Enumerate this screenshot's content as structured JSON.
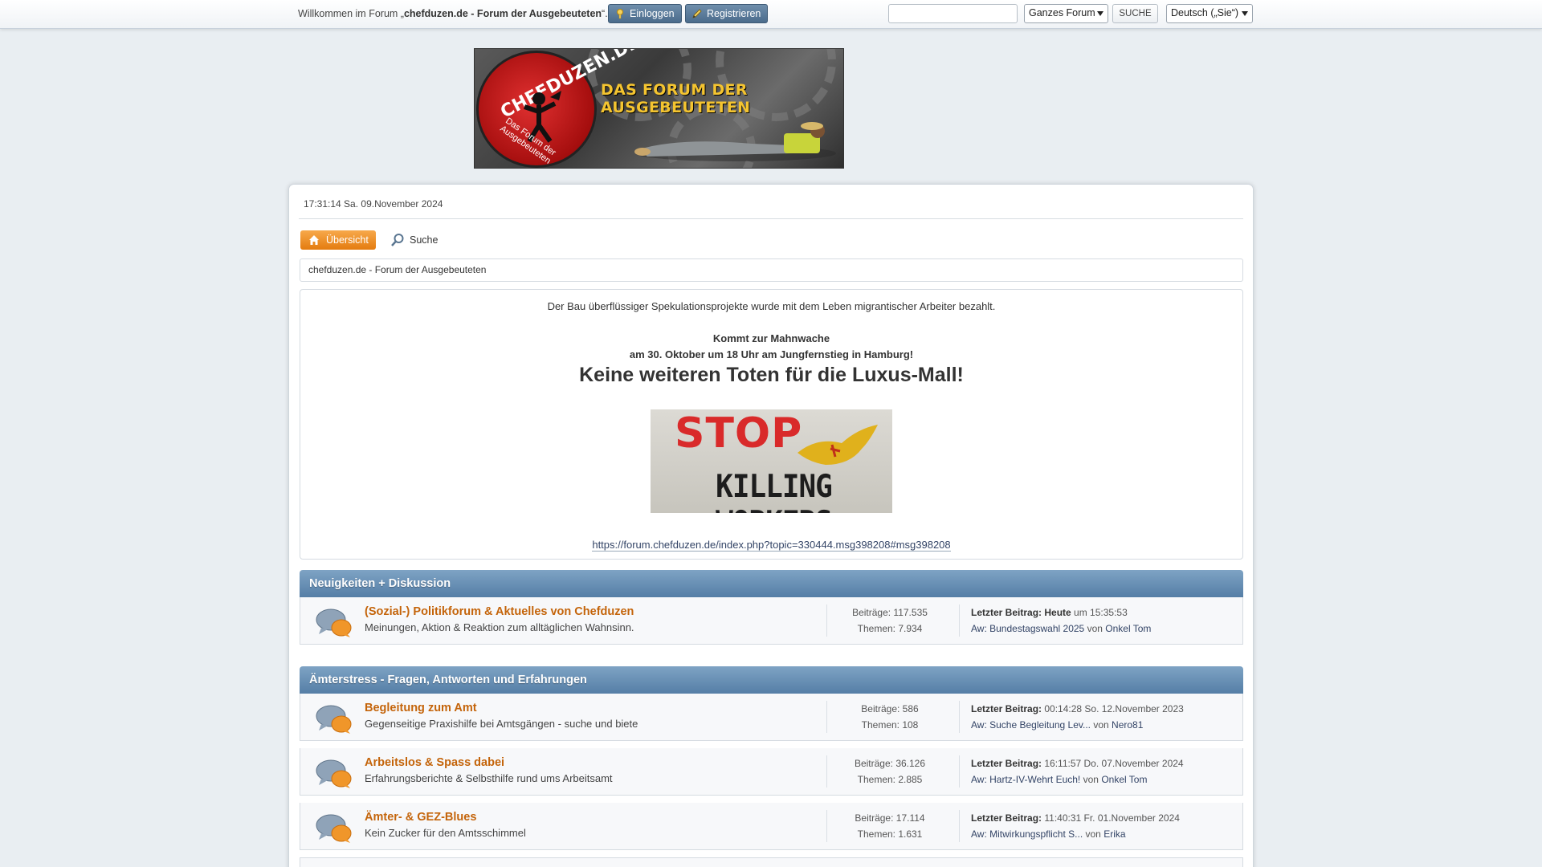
{
  "topbar": {
    "welcome_prefix": "Willkommen im Forum „",
    "forum_name": "chefduzen.de - Forum der Ausgebeuteten",
    "welcome_suffix": "“.",
    "login_label": "Einloggen",
    "register_label": "Registrieren",
    "search_value": "",
    "scope_selected": "Ganzes Forum",
    "search_button_label": "SUCHE",
    "language_selected": "Deutsch („Sie“)"
  },
  "banner": {
    "site": "CHEFDUZEN.DE",
    "seal_sub": "Das Forum der Ausgebeuteten",
    "title": "DAS FORUM DER AUSGEBEUTETEN"
  },
  "header": {
    "datetime": "17:31:14 Sa. 09.November 2024"
  },
  "nav": {
    "home_label": "Übersicht",
    "search_label": "Suche"
  },
  "breadcrumb": "chefduzen.de - Forum der Ausgebeuteten",
  "news": {
    "line1": "Der Bau überflüssiger Spekulationsprojekte wurde mit dem Leben migrantischer Arbeiter bezahlt.",
    "line2": "Kommt zur Mahnwache",
    "line3": "am 30. Oktober um 18 Uhr am Jungfernstieg in Hamburg!",
    "headline": "Keine weiteren Toten für die Luxus-Mall!",
    "image_text_top": "STOP",
    "image_text_bottom": "KILLING WORKERS",
    "link": "https://forum.chefduzen.de/index.php?topic=330444.msg398208#msg398208"
  },
  "categories": [
    {
      "title": "Neuigkeiten + Diskussion",
      "boards": [
        {
          "title": "(Sozial-) Politikforum & Aktuelles von Chefduzen",
          "description": "Meinungen, Aktion & Reaktion zum alltäglichen Wahnsinn.",
          "posts": "Beiträge: 117.535",
          "topics": "Themen: 7.934",
          "last_label": "Letzter Beitrag:",
          "last_time_bold": "Heute",
          "last_time": "um 15:35:53",
          "last_topic": "Aw: Bundestagswahl 2025",
          "by": "von",
          "last_user": "Onkel Tom"
        }
      ]
    },
    {
      "title": "Ämterstress - Fragen, Antworten und Erfahrungen",
      "boards": [
        {
          "title": "Begleitung zum Amt",
          "description": "Gegenseitige Praxishilfe bei Amtsgängen - suche und biete",
          "posts": "Beiträge: 586",
          "topics": "Themen: 108",
          "last_label": "Letzter Beitrag:",
          "last_time_bold": "",
          "last_time": "00:14:28 So. 12.November 2023",
          "last_topic": "Aw: Suche Begleitung Lev...",
          "by": "von",
          "last_user": "Nero81"
        },
        {
          "title": "Arbeitslos & Spass dabei",
          "description": "Erfahrungsberichte & Selbsthilfe rund ums Arbeitsamt",
          "posts": "Beiträge: 36.126",
          "topics": "Themen: 2.885",
          "last_label": "Letzter Beitrag:",
          "last_time_bold": "",
          "last_time": "16:11:57 Do. 07.November 2024",
          "last_topic": "Aw: Hartz-IV-Wehrt Euch!",
          "by": "von",
          "last_user": "Onkel Tom"
        },
        {
          "title": "Ämter- & GEZ-Blues",
          "description": "Kein Zucker für den  Amtsschimmel",
          "posts": "Beiträge: 17.114",
          "topics": "Themen: 1.631",
          "last_label": "Letzter Beitrag:",
          "last_time_bold": "",
          "last_time": "11:40:31 Fr. 01.November 2024",
          "last_topic": "Aw: Mitwirkungspflicht S...",
          "by": "von",
          "last_user": "Erika"
        }
      ]
    }
  ],
  "colors": {
    "accent_orange": "#e47c0f",
    "board_title": "#c4640a",
    "header_blue": "#557ea6"
  }
}
